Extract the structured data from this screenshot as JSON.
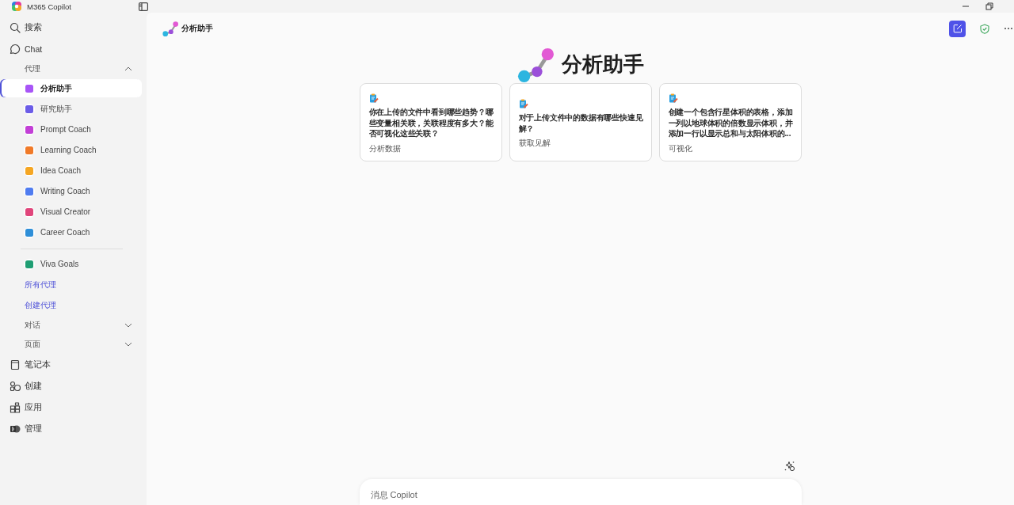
{
  "window": {
    "title": "M365 Copilot"
  },
  "sidebar": {
    "top_items": [
      {
        "label": "搜索"
      },
      {
        "label": "Chat"
      }
    ],
    "agents_section": {
      "label": "代理",
      "expanded": true
    },
    "agents": [
      {
        "label": "分析助手",
        "selected": true,
        "color": "#a855f7"
      },
      {
        "label": "研究助手",
        "selected": false,
        "color": "#6b5ce7"
      },
      {
        "label": "Prompt Coach",
        "selected": false,
        "color": "#c23fd6"
      },
      {
        "label": "Learning Coach",
        "selected": false,
        "color": "#f07a28"
      },
      {
        "label": "Idea Coach",
        "selected": false,
        "color": "#f5a623"
      },
      {
        "label": "Writing Coach",
        "selected": false,
        "color": "#4f7cf0"
      },
      {
        "label": "Visual Creator",
        "selected": false,
        "color": "#e0457b"
      },
      {
        "label": "Career Coach",
        "selected": false,
        "color": "#2f8fd8"
      }
    ],
    "pinned_agents": [
      {
        "label": "Viva Goals",
        "selected": false,
        "color": "#1f9e73"
      }
    ],
    "links": [
      {
        "label": "所有代理"
      },
      {
        "label": "创建代理"
      }
    ],
    "sections": [
      {
        "label": "对话",
        "expanded": false
      },
      {
        "label": "页面",
        "expanded": false
      }
    ],
    "bottom_items": [
      {
        "label": "笔记本"
      },
      {
        "label": "创建"
      },
      {
        "label": "应用"
      },
      {
        "label": "管理"
      }
    ]
  },
  "header": {
    "title": "分析助手"
  },
  "hero": {
    "title": "分析助手"
  },
  "cards": [
    {
      "text": "你在上传的文件中看到哪些趋势？哪些变量相关联，关联程度有多大？能否可视化这些关联？",
      "tag": "分析数据"
    },
    {
      "text": "对于上传文件中的数据有哪些快速见解？",
      "tag": "获取见解"
    },
    {
      "text": "创建一个包含行星体积的表格，添加一列以地球体积的倍数显示体积，并添加一行以显示总和与太阳体积的...",
      "tag": "可视化"
    }
  ],
  "composer": {
    "placeholder": "消息 Copilot"
  }
}
